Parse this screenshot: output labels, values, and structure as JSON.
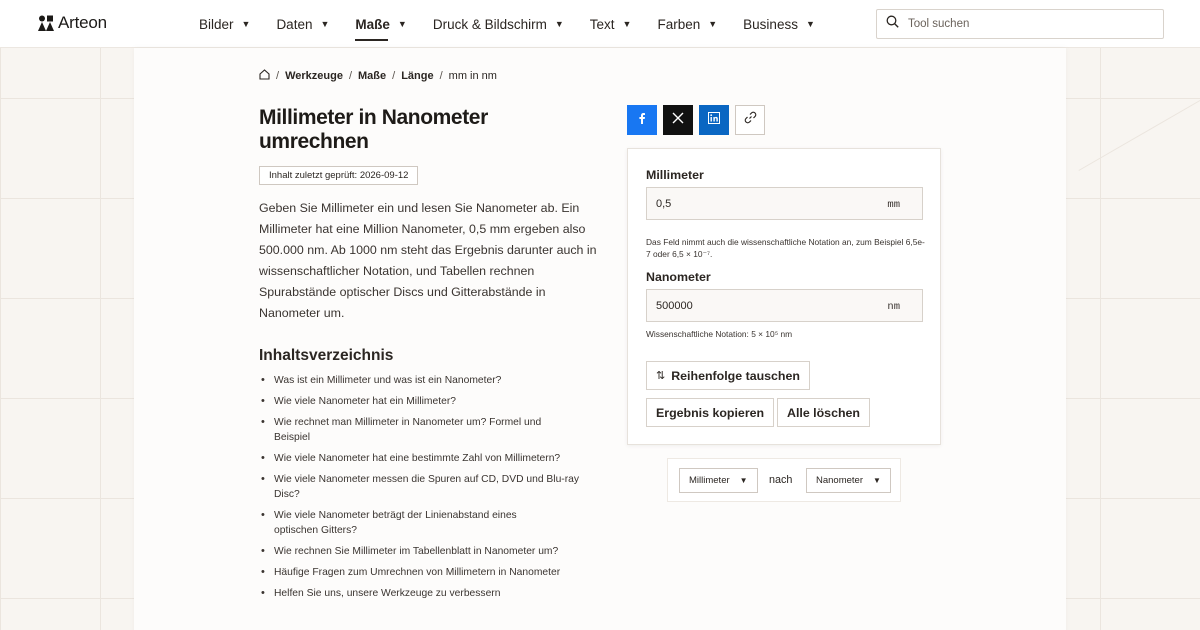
{
  "brand": {
    "name": "Arteon"
  },
  "nav": [
    {
      "label": "Bilder",
      "active": false
    },
    {
      "label": "Daten",
      "active": false
    },
    {
      "label": "Maße",
      "active": true
    },
    {
      "label": "Druck & Bildschirm",
      "active": false
    },
    {
      "label": "Text",
      "active": false
    },
    {
      "label": "Farben",
      "active": false
    },
    {
      "label": "Business",
      "active": false
    }
  ],
  "search": {
    "placeholder": "Tool suchen"
  },
  "breadcrumb": [
    "Werkzeuge",
    "Maße",
    "Länge",
    "mm in nm"
  ],
  "page": {
    "title": "Millimeter in Nanometer umrechnen",
    "badge": "Inhalt zuletzt geprüft: 2026-09-12",
    "intro": "Geben Sie Millimeter ein und lesen Sie Nanometer ab. Ein Millimeter hat eine Million Nanometer, 0,5 mm ergeben also 500.000 nm. Ab 1000 nm steht das Ergebnis darunter auch in wissenschaftlicher Notation, und Tabellen rechnen Spurabstände optischer Discs und Gitterabstände in Nanometer um."
  },
  "toc": {
    "title": "Inhaltsverzeichnis",
    "items": [
      "Was ist ein Millimeter und was ist ein Nanometer?",
      "Wie viele Nanometer hat ein Millimeter?",
      "Wie rechnet man Millimeter in Nanometer um? Formel und Beispiel",
      "Wie viele Nanometer hat eine bestimmte Zahl von Millimetern?",
      "Wie viele Nanometer messen die Spuren auf CD, DVD und Blu-ray Disc?",
      "Wie viele Nanometer beträgt der Linienabstand eines optischen Gitters?",
      "Wie rechnen Sie Millimeter im Tabellenblatt in Nanometer um?",
      "Häufige Fragen zum Umrechnen von Millimetern in Nanometer",
      "Helfen Sie uns, unsere Werkzeuge zu verbessern"
    ]
  },
  "share": {
    "icons": [
      "facebook-icon",
      "x-icon",
      "linkedin-icon",
      "link-icon"
    ],
    "colors": {
      "facebook": "#1877f2",
      "x": "#111111",
      "linkedin": "#0a66c2"
    }
  },
  "converter": {
    "from_label": "Millimeter",
    "from_value": "0,5",
    "from_unit": "mm",
    "from_help": "Das Feld nimmt auch die wissenschaftliche Notation an, zum Beispiel 6,5e-7 oder 6,5 × 10⁻⁷.",
    "to_label": "Nanometer",
    "to_value": "500000",
    "to_unit": "nm",
    "to_help": "Wissenschaftliche Notation: 5 × 10⁵ nm",
    "swap_label": "Reihenfolge tauschen",
    "copy_label": "Ergebnis kopieren",
    "clear_label": "Alle löschen"
  },
  "unit_select": {
    "from": "Millimeter",
    "joiner": "nach",
    "to": "Nanometer"
  }
}
